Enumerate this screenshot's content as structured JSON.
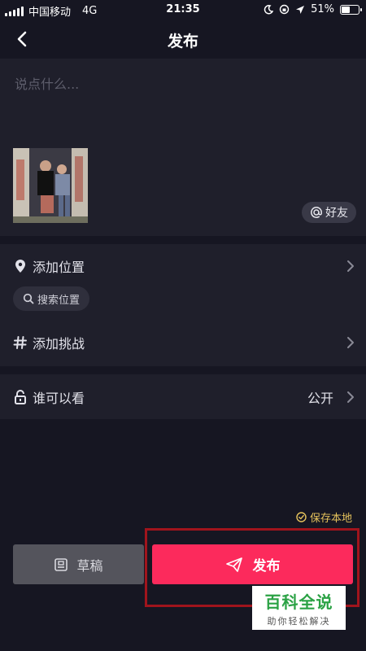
{
  "status_bar": {
    "carrier": "中国移动",
    "network": "4G",
    "time": "21:35",
    "battery": "51%",
    "battery_level": 0.51
  },
  "header": {
    "title": "发布"
  },
  "caption": {
    "placeholder": "说点什么..."
  },
  "friend_chip": {
    "label": "好友"
  },
  "location": {
    "label": "添加位置",
    "search_label": "搜索位置"
  },
  "challenge": {
    "label": "添加挑战"
  },
  "visibility": {
    "label": "谁可以看",
    "value": "公开"
  },
  "save_local": {
    "label": "保存本地"
  },
  "buttons": {
    "draft_label": "草稿",
    "publish_label": "发布"
  },
  "watermark": {
    "title": "百科全说",
    "subtitle": "助你轻松解决"
  },
  "colors": {
    "background": "#161622",
    "panel": "#1f1f2b",
    "accent": "#fc2a5c",
    "draft": "#54545c",
    "save_local": "#e5c25c",
    "highlight": "#a0141c"
  },
  "icons": [
    "back-arrow-icon",
    "location-pin-icon",
    "search-icon",
    "hashtag-icon",
    "lock-icon",
    "chevron-right-icon",
    "check-circle-icon",
    "draft-box-icon",
    "paper-plane-icon",
    "at-icon"
  ]
}
